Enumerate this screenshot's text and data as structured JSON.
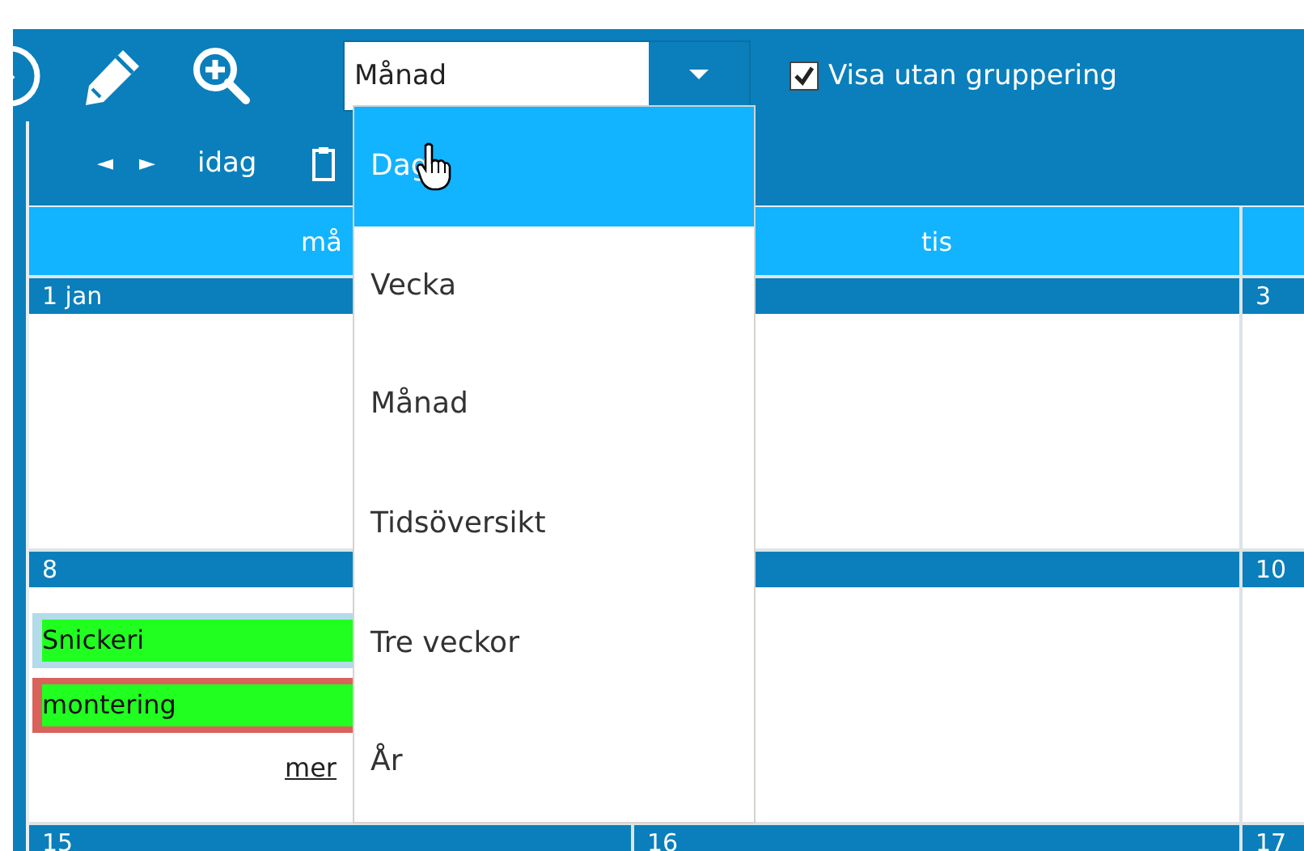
{
  "toolbar": {
    "view_select": {
      "value": "Månad",
      "expanded": true,
      "options": [
        {
          "label": "Dag",
          "highlighted": true
        },
        {
          "label": "Vecka",
          "highlighted": false
        },
        {
          "label": "Månad",
          "highlighted": false
        },
        {
          "label": "Tidsöversikt",
          "highlighted": false
        },
        {
          "label": "Tre veckor",
          "highlighted": false
        },
        {
          "label": "År",
          "highlighted": false
        }
      ]
    },
    "show_ungrouped": {
      "label": "Visa utan gruppering",
      "checked": true
    }
  },
  "nav": {
    "prev": "◄",
    "next": "►",
    "today": "idag"
  },
  "calendar": {
    "day_headers": [
      "må",
      "tis"
    ],
    "weeks": [
      {
        "column_1": {
          "date": "1 jan"
        },
        "column_3": {
          "date": "3"
        }
      },
      {
        "column_1": {
          "date": "8",
          "events": [
            {
              "title": "Snickeri",
              "color": "#b3dbe9"
            },
            {
              "title": "montering",
              "color": "#d9625c"
            }
          ],
          "more": "mer"
        },
        "column_3": {
          "date": "10"
        }
      },
      {
        "column_1": {
          "date": "15"
        },
        "column_2": {
          "date": "16"
        },
        "column_3": {
          "date": "17"
        }
      }
    ]
  }
}
